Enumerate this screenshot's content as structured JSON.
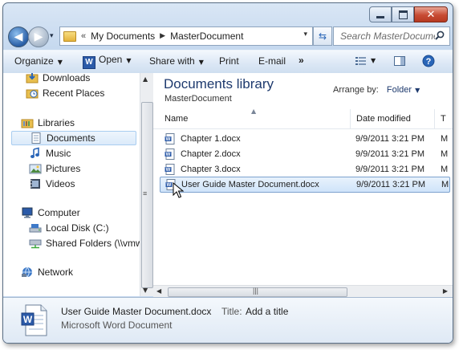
{
  "address": {
    "overflow_chevron": "«",
    "crumbs": [
      "My Documents",
      "MasterDocument"
    ],
    "separator": "▶",
    "dropdown": "▾"
  },
  "search": {
    "placeholder": "Search MasterDocument"
  },
  "toolbar": {
    "organize": "Organize",
    "open": "Open",
    "share_with": "Share with",
    "print": "Print",
    "email": "E-mail",
    "overflow": "»",
    "dropdown": "▼"
  },
  "nav_pane": {
    "favorites": [
      {
        "label": "Downloads",
        "icon": "downloads-folder-icon"
      },
      {
        "label": "Recent Places",
        "icon": "recent-places-icon"
      }
    ],
    "libraries_header": "Libraries",
    "libraries": [
      {
        "label": "Documents",
        "icon": "documents-library-icon",
        "selected": true
      },
      {
        "label": "Music",
        "icon": "music-icon"
      },
      {
        "label": "Pictures",
        "icon": "pictures-icon"
      },
      {
        "label": "Videos",
        "icon": "videos-icon"
      }
    ],
    "computer_header": "Computer",
    "computer": [
      {
        "label": "Local Disk (C:)",
        "icon": "local-disk-icon"
      },
      {
        "label": "Shared Folders (\\\\vmware",
        "icon": "network-drive-icon"
      }
    ],
    "network": "Network"
  },
  "content": {
    "library_title": "Documents library",
    "library_subtitle": "MasterDocument",
    "arrange_by_label": "Arrange by:",
    "arrange_by_value": "Folder",
    "columns": {
      "name": "Name",
      "date_modified": "Date modified",
      "type": "T"
    },
    "files": [
      {
        "name": "Chapter 1.docx",
        "date": "9/9/2011 3:21 PM",
        "type": "M",
        "selected": false
      },
      {
        "name": "Chapter 2.docx",
        "date": "9/9/2011 3:21 PM",
        "type": "M",
        "selected": false
      },
      {
        "name": "Chapter 3.docx",
        "date": "9/9/2011 3:21 PM",
        "type": "M",
        "selected": false
      },
      {
        "name": "User Guide Master Document.docx",
        "date": "9/9/2011 3:21 PM",
        "type": "M",
        "selected": true
      }
    ]
  },
  "details": {
    "file_name": "User Guide Master Document.docx",
    "title_label": "Title:",
    "title_value": "Add a title",
    "file_type": "Microsoft Word Document"
  },
  "colors": {
    "window_frame": "#c6d9ef",
    "selection_border": "#7da2ce",
    "library_title": "#1e3a6e",
    "close_button": "#c74b33"
  }
}
